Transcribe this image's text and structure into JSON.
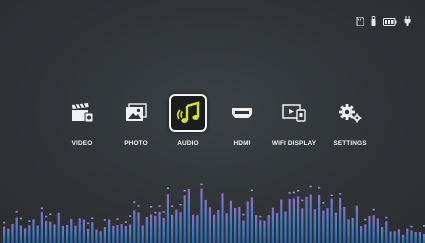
{
  "status_icons": [
    "sd-card-icon",
    "usb-drive-icon",
    "battery-icon",
    "power-plug-icon"
  ],
  "menu": {
    "items": [
      {
        "label": "VIDEO",
        "icon": "video-clapper-icon"
      },
      {
        "label": "PHOTO",
        "icon": "photo-icon"
      },
      {
        "label": "AUDIO",
        "icon": "music-note-icon",
        "selected": true
      },
      {
        "label": "HDMI",
        "icon": "hdmi-port-icon"
      },
      {
        "label": "WIFI DISPLAY",
        "icon": "screen-mirror-icon"
      },
      {
        "label": "SETTINGS",
        "icon": "gears-icon"
      }
    ]
  },
  "colors": {
    "background": "#303437",
    "label": "#f0f0f0",
    "selected_icon_bg": "#1b1c1e",
    "selected_border": "#f2f2f2",
    "accent_yellow": "#d8e02a",
    "eq_blue": "#3f7fd0",
    "eq_purple": "#8a6ad4"
  }
}
